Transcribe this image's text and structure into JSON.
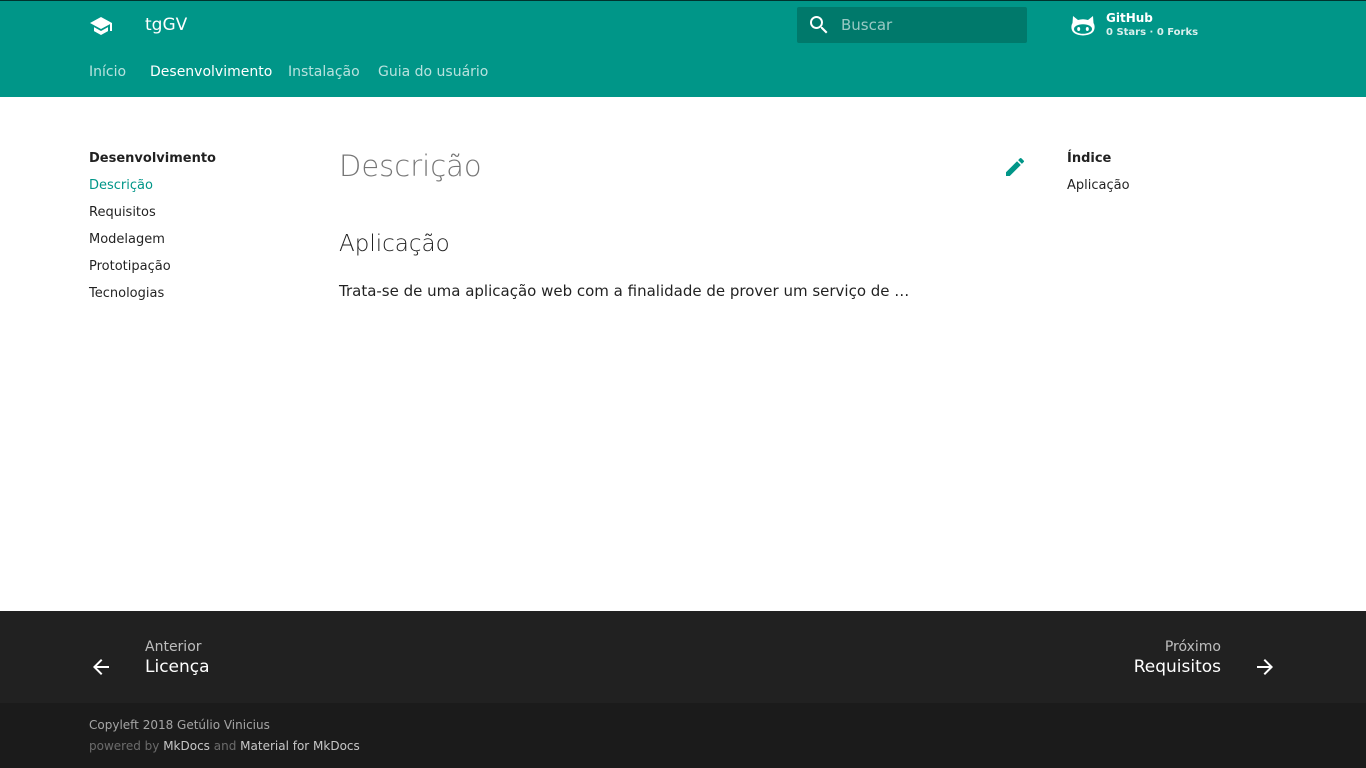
{
  "header": {
    "site_title": "tgGV",
    "logo_icon": "school-icon",
    "search": {
      "placeholder": "Buscar",
      "value": ""
    },
    "repo": {
      "name": "GitHub",
      "facts": "0 Stars · 0 Forks",
      "icon": "octocat-icon"
    },
    "tabs": [
      {
        "label": "Início",
        "active": false
      },
      {
        "label": "Desenvolvimento",
        "active": true
      },
      {
        "label": "Instalação",
        "active": false
      },
      {
        "label": "Guia do usuário",
        "active": false
      }
    ]
  },
  "sidebar": {
    "title": "Desenvolvimento",
    "items": [
      {
        "label": "Descrição",
        "active": true
      },
      {
        "label": "Requisitos",
        "active": false
      },
      {
        "label": "Modelagem",
        "active": false
      },
      {
        "label": "Prototipação",
        "active": false
      },
      {
        "label": "Tecnologias",
        "active": false
      }
    ]
  },
  "content": {
    "title": "Descrição",
    "sections": [
      {
        "heading": "Aplicação",
        "text": "Trata-se de uma aplicação web com a finalidade de prover um serviço de …"
      }
    ]
  },
  "toc": {
    "title": "Índice",
    "items": [
      "Aplicação"
    ]
  },
  "footer": {
    "prev": {
      "direction": "Anterior",
      "title": "Licença"
    },
    "next": {
      "direction": "Próximo",
      "title": "Requisitos"
    },
    "copyright": "Copyleft 2018 Getúlio Vinicius",
    "powered_prefix": "powered by",
    "powered_link1": "MkDocs",
    "powered_and": "and",
    "powered_link2": "Material for MkDocs"
  },
  "colors": {
    "primary": "#009688",
    "primary_dark": "#00796b",
    "accent": "#009688",
    "footer_bg": "#212121",
    "footer_meta_bg": "#1b1b1b"
  }
}
